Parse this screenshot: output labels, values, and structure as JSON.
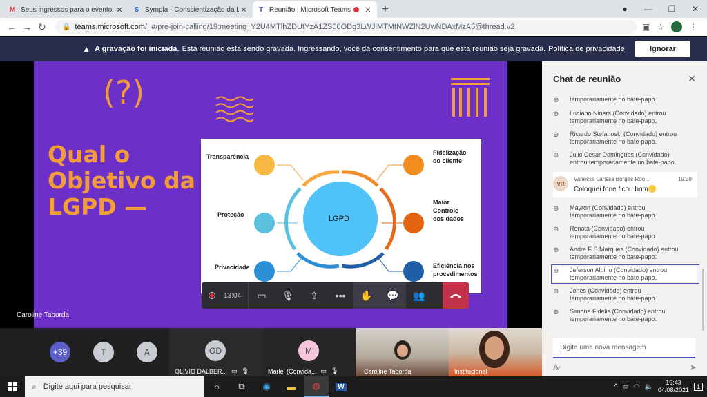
{
  "browser": {
    "tabs": [
      {
        "label": "Seus ingressos para o evento: Co",
        "icon": "gmail-icon",
        "icon_text": "M",
        "icon_color": "#d93025"
      },
      {
        "label": "Sympla - Conscientização da LGP",
        "icon": "sympla-icon",
        "icon_text": "S",
        "icon_color": "#1a73e8"
      },
      {
        "label": "Reunião | Microsoft Teams",
        "icon": "teams-icon",
        "icon_text": "T",
        "icon_color": "#5059c9",
        "recording": true
      }
    ],
    "url_host": "teams.microsoft.com",
    "url_path": "/_#/pre-join-calling/19:meeting_Y2U4MTlhZDUtYzA1ZS00ODg3LWJiMTMtNWZlN2UwNDAxMzA5@thread.v2",
    "profile_initial": "L"
  },
  "banner": {
    "bold": "A gravação foi iniciada.",
    "text": "Esta reunião está sendo gravada. Ingressando, você dá consentimento para que esta reunião seja gravada.",
    "link": "Política de privacidade",
    "button": "Ignorar"
  },
  "slide": {
    "question": "(?)",
    "title_lines": [
      "Qual o",
      "Objetivo da",
      "LGPD —"
    ],
    "center": "LGPD",
    "labels_left": [
      "Transparência",
      "Proteção",
      "Privacidade"
    ],
    "labels_right": [
      [
        "Fidelização",
        "do cliente"
      ],
      [
        "Maior",
        "Controle",
        "dos dados"
      ],
      [
        "Eficiência nos",
        "procedimentos"
      ]
    ],
    "presenter": "Caroline Taborda"
  },
  "controls": {
    "timer": "13:04"
  },
  "participants": [
    {
      "initials": "+39",
      "color": "#5b5fc7"
    },
    {
      "initials": "T",
      "color": "#c9cbd3"
    },
    {
      "initials": "A",
      "color": "#c9cbd3"
    },
    {
      "initials": "OD",
      "color": "#c9cbd3",
      "name": "OLIVIO DALBER..."
    },
    {
      "initials": "M",
      "color": "#f3c6d9",
      "name": "Marlei (Convida..."
    },
    {
      "name": "Caroline Taborda"
    },
    {
      "name": "Institucional"
    }
  ],
  "chat": {
    "title": "Chat de reunião",
    "messages": [
      {
        "type": "sys",
        "name": "",
        "text": "temporariamente no bate-papo."
      },
      {
        "type": "sys",
        "name": "Luciano Niners (Convidado) entrou",
        "text": "temporariamente no bate-papo."
      },
      {
        "type": "sys",
        "name": "Ricardo Stefanoski (Convidado) entrou",
        "text": "temporariamente no bate-papo."
      },
      {
        "type": "sys",
        "name": "Julio Cesar Domingues (Convidado)",
        "text": "entrou temporariamente no bate-papo."
      },
      {
        "type": "msg",
        "avatar": "VR",
        "name": "Vanessa Larissa Borges Roo...",
        "time": "19:39",
        "text": "Coloquei fone ficou bom"
      },
      {
        "type": "sys",
        "name": "Mayron (Convidado) entrou",
        "text": "temporariamente no bate-papo."
      },
      {
        "type": "sys",
        "name": "Renata (Convidado) entrou",
        "text": "temporariamente no bate-papo."
      },
      {
        "type": "sys",
        "name": "Andre F S Marques (Convidado) entrou",
        "text": "temporariamente no bate-papo."
      },
      {
        "type": "sys",
        "name": "Jeferson Albino (Convidado) entrou",
        "text": "temporariamente no bate-papo.",
        "selected": true
      },
      {
        "type": "sys",
        "name": "Jones (Convidado) entrou",
        "text": "temporariamente no bate-papo."
      },
      {
        "type": "sys",
        "name": "Simone Fidelis (Convidado) entrou",
        "text": "temporariamente no bate-papo."
      }
    ],
    "compose_placeholder": "Digite uma nova mensagem"
  },
  "taskbar": {
    "search_placeholder": "Digite aqui para pesquisar",
    "time": "19:43",
    "date": "04/08/2021",
    "notifications": "1"
  }
}
